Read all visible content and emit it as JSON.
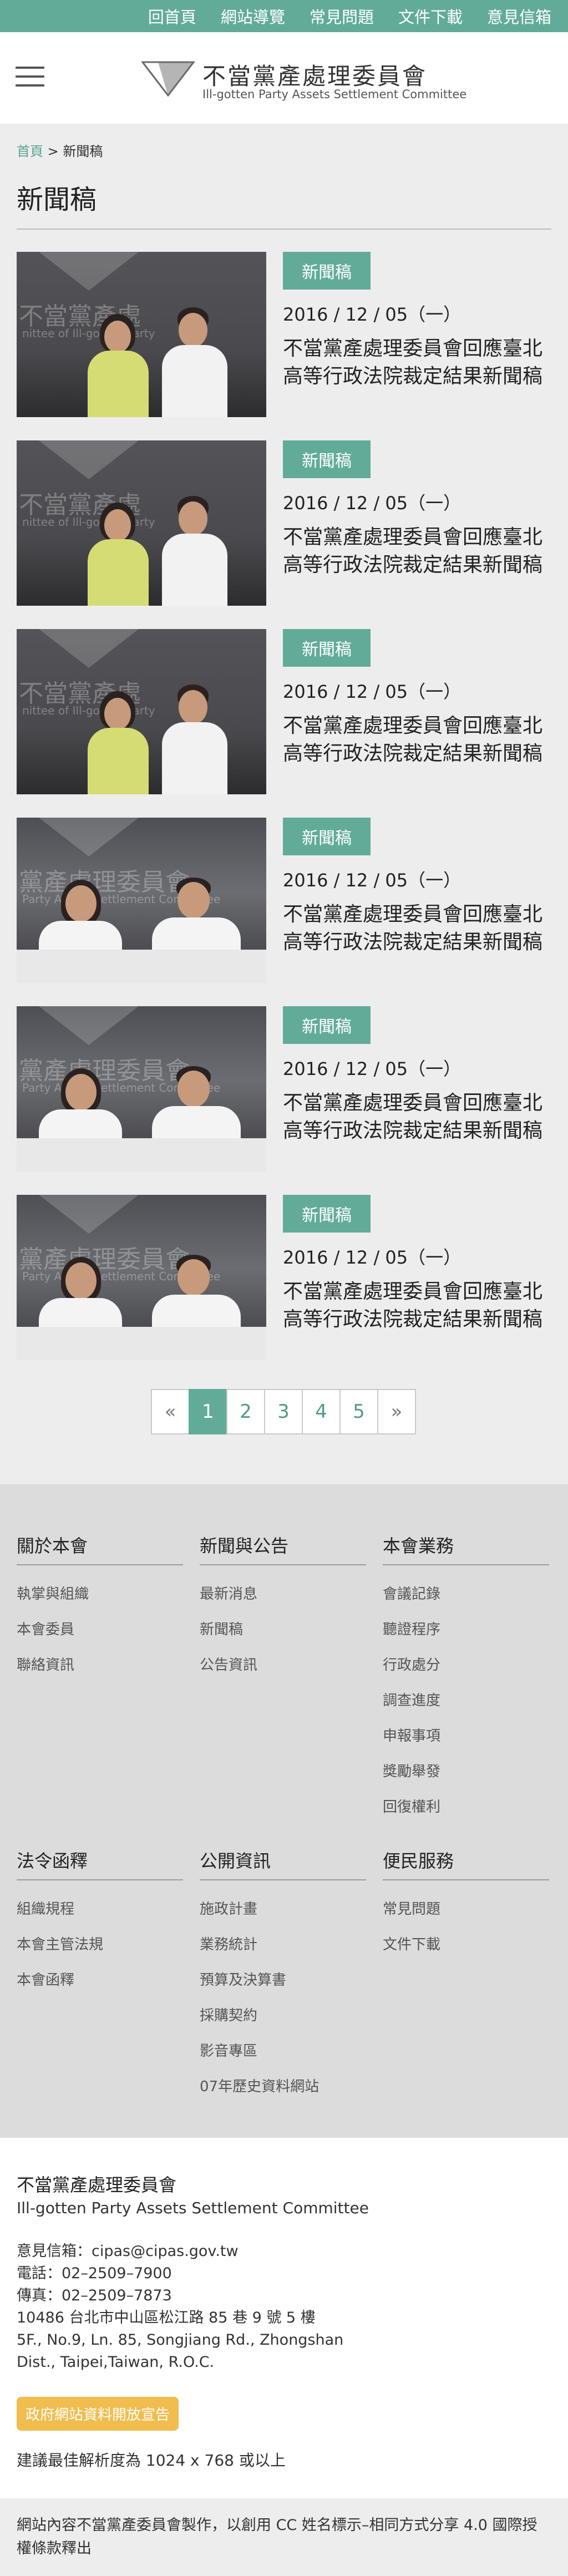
{
  "topnav": [
    "回首頁",
    "網站導覽",
    "常見問題",
    "文件下載",
    "意見信箱"
  ],
  "logo": {
    "zh": "不當黨產處理委員會",
    "en": "Ill-gotten Party Assets Settlement Committee"
  },
  "breadcrumb": {
    "home": "首頁",
    "sep": ">",
    "current": "新聞稿"
  },
  "page_title": "新聞稿",
  "news": [
    {
      "tag": "新聞稿",
      "date": "2016 / 12 / 05（一）",
      "title": "不當黨產處理委員會回應臺北高等行政法院裁定結果新聞稿",
      "photo": "type-a"
    },
    {
      "tag": "新聞稿",
      "date": "2016 / 12 / 05（一）",
      "title": "不當黨產處理委員會回應臺北高等行政法院裁定結果新聞稿",
      "photo": "type-a"
    },
    {
      "tag": "新聞稿",
      "date": "2016 / 12 / 05（一）",
      "title": "不當黨產處理委員會回應臺北高等行政法院裁定結果新聞稿",
      "photo": "type-a"
    },
    {
      "tag": "新聞稿",
      "date": "2016 / 12 / 05（一）",
      "title": "不當黨產處理委員會回應臺北高等行政法院裁定結果新聞稿",
      "photo": "type-b"
    },
    {
      "tag": "新聞稿",
      "date": "2016 / 12 / 05（一）",
      "title": "不當黨產處理委員會回應臺北高等行政法院裁定結果新聞稿",
      "photo": "type-b"
    },
    {
      "tag": "新聞稿",
      "date": "2016 / 12 / 05（一）",
      "title": "不當黨產處理委員會回應臺北高等行政法院裁定結果新聞稿",
      "photo": "type-b"
    }
  ],
  "photo_text": {
    "zh_a": "不當黨產處",
    "en_a": "nittee of Ill-gotten party",
    "zh_b": "黨產處理委員會",
    "en_b": "Party Assets Settlement Committee"
  },
  "pagination": {
    "prev": "«",
    "pages": [
      "1",
      "2",
      "3",
      "4",
      "5"
    ],
    "current": "1",
    "next": "»"
  },
  "sitemap": [
    {
      "heading": "關於本會",
      "links": [
        "執掌與組織",
        "本會委員",
        "聯絡資訊"
      ]
    },
    {
      "heading": "新聞與公告",
      "links": [
        "最新消息",
        "新聞稿",
        "公告資訊"
      ]
    },
    {
      "heading": "本會業務",
      "links": [
        "會議記錄",
        "聽證程序",
        "行政處分",
        "調查進度",
        "申報事項",
        "獎勵舉發",
        "回復權利"
      ]
    },
    {
      "heading": "法令函釋",
      "links": [
        "組織規程",
        "本會主管法規",
        "本會函釋"
      ]
    },
    {
      "heading": "公開資訊",
      "links": [
        "施政計畫",
        "業務統計",
        "預算及決算書",
        "採購契約",
        "影音專區",
        "07年歷史資料網站"
      ]
    },
    {
      "heading": "便民服務",
      "links": [
        "常見問題",
        "文件下載"
      ]
    }
  ],
  "footer_info": {
    "org_zh": "不當黨產處理委員會",
    "org_en": "Ill-gotten Party Assets Settlement Committee",
    "lines": [
      "意見信箱：cipas@cipas.gov.tw",
      "電話：02–2509–7900",
      "傳真：02–2509–7873",
      "10486 台北市中山區松江路 85 巷 9 號 5 樓",
      "5F., No.9, Ln. 85, Songjiang Rd., Zhongshan",
      "Dist., Taipei,Taiwan, R.O.C."
    ],
    "open_data": "政府網站資料開放宣告",
    "resolution": "建議最佳解析度為 1024 x 768 或以上"
  },
  "copyright": "網站內容不當黨產委員會製作，以創用 CC 姓名標示–相同方式分享 4.0 國際授權條款釋出",
  "colors": {
    "accent": "#62ab99",
    "open_data": "#f0bd4e"
  }
}
